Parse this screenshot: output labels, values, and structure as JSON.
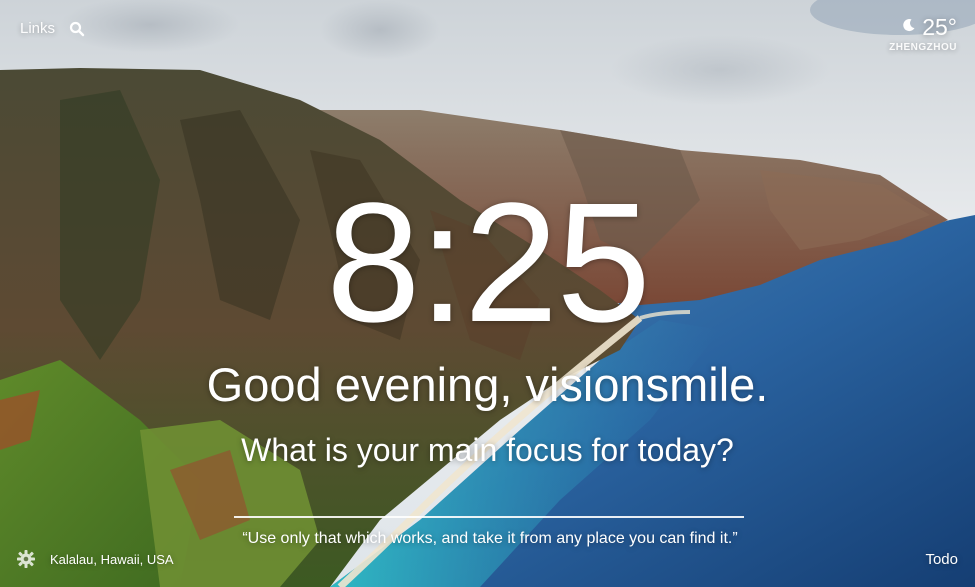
{
  "top_bar": {
    "links_label": "Links",
    "search_icon": "search-icon"
  },
  "weather": {
    "icon": "moon-icon",
    "temperature": "25°",
    "location": "ZHENGZHOU"
  },
  "clock": {
    "time": "8:25"
  },
  "greeting": {
    "text": "Good evening, visionsmile."
  },
  "focus": {
    "question": "What is your main focus for today?"
  },
  "quote": {
    "text": "“Use only that which works, and take it from any place you can find it.”"
  },
  "footer": {
    "settings_icon": "gear-icon",
    "photo_location": "Kalalau, Hawaii, USA",
    "todo_label": "Todo"
  },
  "colors": {
    "sky_light": "#e9ecee",
    "sky_cloud": "#c8ced3",
    "mountain_dark": "#3f4a2f",
    "mountain_red": "#8a5a3c",
    "vegetation": "#5b7a2c",
    "ocean_deep": "#1f4f86",
    "ocean_turquoise": "#2cb5c4",
    "text": "#ffffff"
  }
}
